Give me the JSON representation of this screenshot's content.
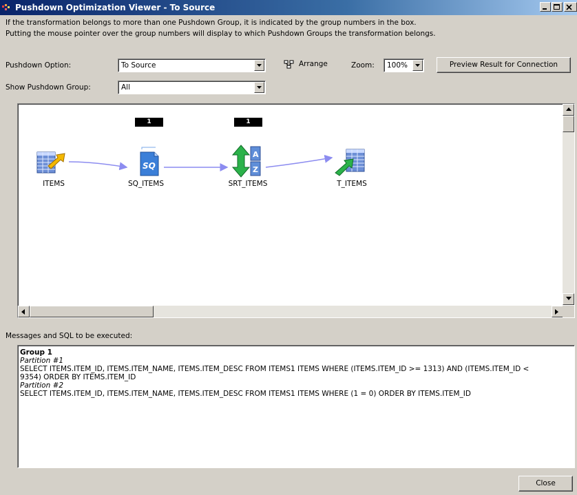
{
  "window": {
    "title": "Pushdown Optimization Viewer -  To Source",
    "icons": {
      "app": "informatica-app-icon",
      "minimize": "minimize-icon",
      "maximize": "maximize-icon",
      "close": "close-x-icon"
    }
  },
  "info": {
    "line1": "If the transformation belongs to more than one Pushdown Group, it is indicated by the group numbers in the box.",
    "line2": "Putting the mouse pointer over the group numbers will display to which Pushdown Groups the transformation belongs."
  },
  "toolbar": {
    "pushdown_option_label": "Pushdown Option:",
    "pushdown_option_value": "To Source",
    "arrange_label": "Arrange",
    "zoom_label": "Zoom:",
    "zoom_value": "100%",
    "preview_button": "Preview Result for Connection",
    "show_group_label": "Show Pushdown Group:",
    "show_group_value": "All"
  },
  "mapping": {
    "nodes": [
      {
        "name": "ITEMS",
        "icon": "source-definition-icon",
        "badge": ""
      },
      {
        "name": "SQ_ITEMS",
        "icon": "source-qualifier-icon",
        "badge": "1"
      },
      {
        "name": "SRT_ITEMS",
        "icon": "sorter-icon",
        "badge": "1"
      },
      {
        "name": "T_ITEMS",
        "icon": "target-definition-icon",
        "badge": ""
      }
    ]
  },
  "messages": {
    "label": "Messages and SQL to be executed:",
    "group": "Group 1",
    "partition1": "Partition #1",
    "sql1_line1": "SELECT ITEMS.ITEM_ID, ITEMS.ITEM_NAME, ITEMS.ITEM_DESC FROM ITEMS1 ITEMS WHERE (ITEMS.ITEM_ID >= 1313) AND (ITEMS.ITEM_ID <",
    "sql1_line2": "9354) ORDER BY ITEMS.ITEM_ID",
    "partition2": "Partition #2",
    "sql2": "SELECT ITEMS.ITEM_ID, ITEMS.ITEM_NAME, ITEMS.ITEM_DESC FROM ITEMS1 ITEMS WHERE (1 = 0) ORDER BY ITEMS.ITEM_ID"
  },
  "footer": {
    "close_button": "Close"
  },
  "colors": {
    "title_start": "#0a246a",
    "title_end": "#a6caf0",
    "link_line": "#8c8cf0",
    "badge": "#000000"
  }
}
